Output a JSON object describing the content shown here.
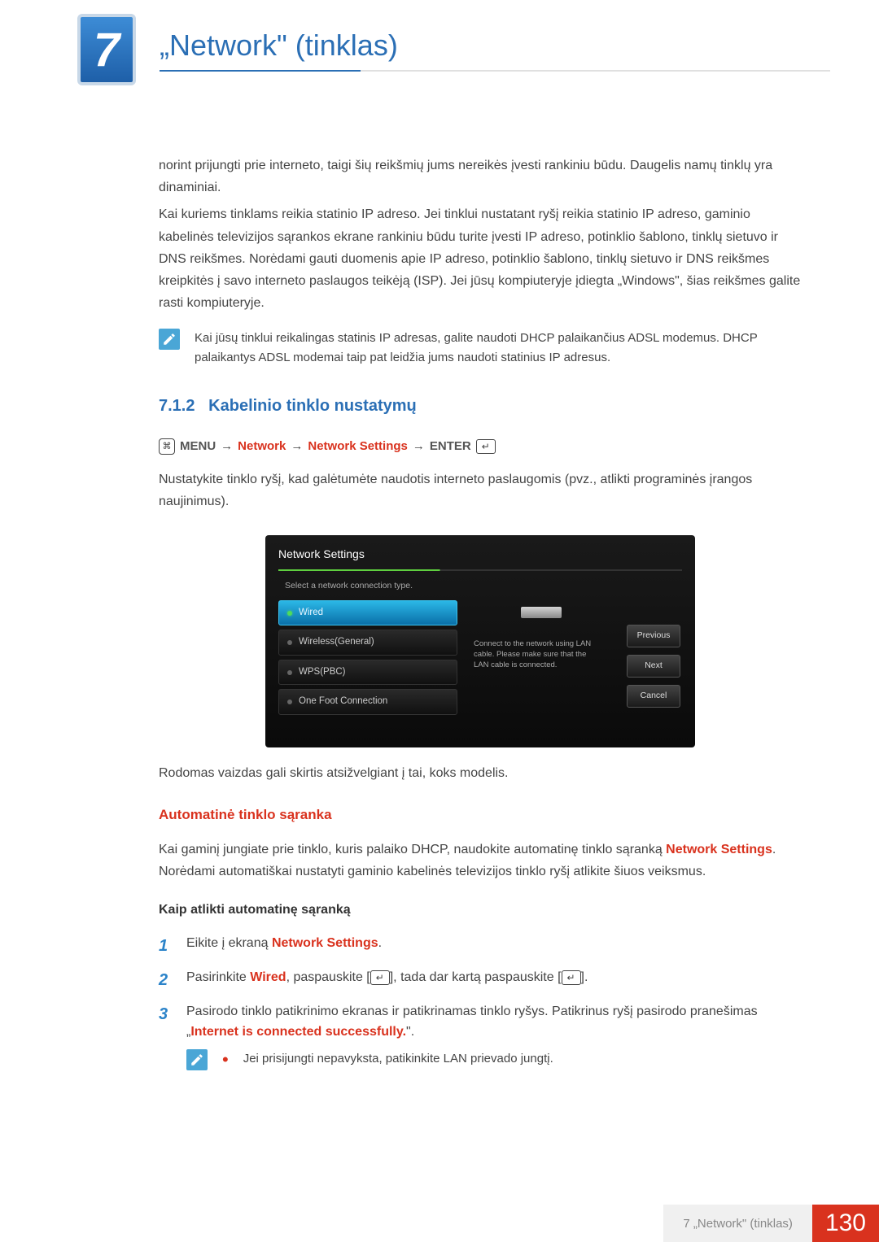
{
  "chapter": {
    "number": "7",
    "title": "„Network\" (tinklas)"
  },
  "intro": {
    "p1": "norint prijungti prie interneto, taigi šių reikšmių jums nereikės įvesti rankiniu būdu. Daugelis namų tinklų yra dinaminiai.",
    "p2": "Kai kuriems tinklams reikia statinio IP adreso. Jei tinklui nustatant ryšį reikia statinio IP adreso, gaminio kabelinės televizijos sąrankos ekrane rankiniu būdu turite įvesti IP adreso, potinklio šablono, tinklų sietuvo ir DNS reikšmes. Norėdami gauti duomenis apie IP adreso, potinklio šablono, tinklų sietuvo ir DNS reikšmes kreipkitės į savo interneto paslaugos teikėją (ISP). Jei jūsų kompiuteryje įdiegta „Windows\", šias reikšmes galite rasti kompiuteryje."
  },
  "note1": "Kai jūsų tinklui reikalingas statinis IP adresas, galite naudoti DHCP palaikančius ADSL modemus. DHCP palaikantys ADSL modemai taip pat leidžia jums naudoti statinius IP adresus.",
  "section": {
    "num": "7.1.2",
    "title": "Kabelinio tinklo nustatymų"
  },
  "menu_path": {
    "menu": "MENU",
    "a": "Network",
    "b": "Network Settings",
    "enter": "ENTER"
  },
  "section_p": "Nustatykite tinklo ryšį, kad galėtumėte naudotis interneto paslaugomis (pvz., atlikti programinės įrangos naujinimus).",
  "osd": {
    "title": "Network Settings",
    "hint": "Select a network connection type.",
    "items": [
      "Wired",
      "Wireless(General)",
      "WPS(PBC)",
      "One Foot Connection"
    ],
    "desc": "Connect to the network using LAN cable. Please make sure that the LAN cable is connected.",
    "btns": [
      "Previous",
      "Next",
      "Cancel"
    ]
  },
  "caption": "Rodomas vaizdas gali skirtis atsižvelgiant į tai, koks modelis.",
  "auto": {
    "heading": "Automatinė tinklo sąranka",
    "p_a": "Kai gaminį jungiate prie tinklo, kuris palaiko DHCP, naudokite automatinę tinklo sąranką ",
    "p_b": "Network Settings",
    "p_c": ". Norėdami automatiškai nustatyti gaminio kabelinės televizijos tinklo ryšį atlikite šiuos veiksmus.",
    "sub": "Kaip atlikti automatinę sąranką",
    "steps": {
      "s1a": "Eikite į ekraną ",
      "s1b": "Network Settings",
      "s1c": ".",
      "s2a": "Pasirinkite ",
      "s2b": "Wired",
      "s2c": ", paspauskite [",
      "s2d": "], tada dar kartą paspauskite [",
      "s2e": "].",
      "s3a": "Pasirodo tinklo patikrinimo ekranas ir patikrinamas tinklo ryšys. Patikrinus ryšį pasirodo pranešimas „",
      "s3b": "Internet is connected successfully.",
      "s3c": "\"."
    },
    "note": "Jei prisijungti nepavyksta, patikinkite LAN prievado jungtį."
  },
  "footer": {
    "label": "7 „Network\" (tinklas)",
    "page": "130"
  }
}
